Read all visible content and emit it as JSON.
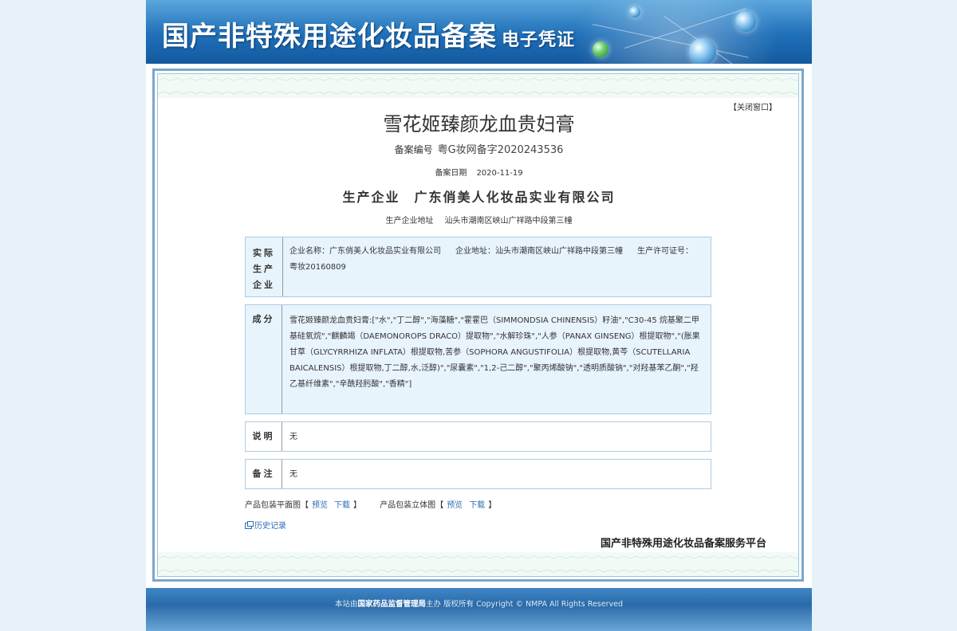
{
  "banner": {
    "title": "国产非特殊用途化妆品备案",
    "subtitle": "电子凭证"
  },
  "close_label": "【关闭窗口】",
  "product": {
    "name": "雪花姬臻颜龙血贵妇膏",
    "reg_label": "备案编号",
    "reg_number": "粤G妆网备字2020243536",
    "date_label": "备案日期",
    "date": "2020-11-19",
    "company_label": "生产企业",
    "company": "广东俏美人化妆品实业有限公司",
    "address_label": "生产企业地址",
    "address": "汕头市潮南区峡山广祥路中段第三幢"
  },
  "actual_producer": {
    "label_lines": [
      "实际",
      "生产",
      "企业"
    ],
    "name_text": "企业名称：广东俏美人化妆品实业有限公司",
    "address_text": "企业地址：汕头市潮南区峡山广祥路中段第三幢",
    "license_text": "生产许可证号：",
    "license_number": "粤妆20160809"
  },
  "ingredients": {
    "label": "成分",
    "text": "雪花姬臻颜龙血贵妇膏:[\"水\",\"丁二醇\",\"海藻糖\",\"霍霍巴（SIMMONDSIA CHINENSIS）籽油\",\"C30-45 烷基聚二甲基硅氧烷\",\"麒麟竭（DAEMONOROPS DRACO）提取物\",\"水解珍珠\",\"人参（PANAX GINSENG）根提取物\",\"(胀果甘草（GLYCYRRHIZA INFLATA）根提取物,苦参（SOPHORA ANGUSTIFOLIA）根提取物,黄芩（SCUTELLARIA BAICALENSIS）根提取物,丁二醇,水,泛醇)\",\"尿囊素\",\"1,2-己二醇\",\"聚丙烯酸钠\",\"透明质酸钠\",\"对羟基苯乙酮\",\"羟乙基纤维素\",\"辛酰羟肟酸\",\"香精\"]"
  },
  "description": {
    "label": "说明",
    "value": "无"
  },
  "remarks": {
    "label": "备注",
    "value": "无"
  },
  "packaging": {
    "flat_label": "产品包装平面图",
    "solid_label": "产品包装立体图",
    "preview": "预览",
    "download": "下载",
    "bracket_open": "【",
    "bracket_close": "】"
  },
  "history_label": "历史记录",
  "platform_name": "国产非特殊用途化妆品备案服务平台",
  "footer": {
    "prefix": "本站由",
    "org": "国家药品监督管理局",
    "suffix": "主办 版权所有 Copyright © NMPA All Rights Reserved"
  }
}
